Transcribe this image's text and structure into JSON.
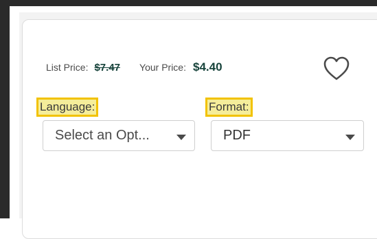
{
  "pricing": {
    "list_label": "List Price:",
    "list_value": "$7.47",
    "your_label": "Your Price:",
    "your_value": "$4.40"
  },
  "wishlist": {
    "icon": "heart-outline-icon"
  },
  "language": {
    "label": "Language:",
    "selected": "Select an Opt..."
  },
  "format": {
    "label": "Format:",
    "selected": "PDF"
  },
  "colors": {
    "price_green": "#17433b",
    "highlight_fill": "#f5ed9a",
    "highlight_border": "#f2c200"
  }
}
